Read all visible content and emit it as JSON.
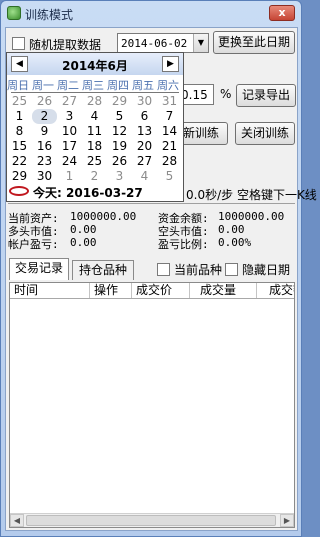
{
  "window": {
    "title": "训练模式",
    "close_label": "x"
  },
  "toolbar": {
    "random_checkbox_label": "随机提取数据",
    "date_value": "2014-06-02",
    "change_date_button": "更换至此日期",
    "percent_value": "0.15",
    "percent_unit": "%",
    "export_button": "记录导出",
    "new_training_button": "新训练",
    "close_training_button": "关闭训练",
    "speed_text": "0.0秒/步 空格键下一K线"
  },
  "calendar": {
    "title": "2014年6月",
    "prev_symbol": "◀",
    "next_symbol": "▶",
    "weekdays": [
      "周日",
      "周一",
      "周二",
      "周三",
      "周四",
      "周五",
      "周六"
    ],
    "weeks": [
      [
        "25",
        "26",
        "27",
        "28",
        "29",
        "30",
        "31"
      ],
      [
        "1",
        "2",
        "3",
        "4",
        "5",
        "6",
        "7"
      ],
      [
        "8",
        "9",
        "10",
        "11",
        "12",
        "13",
        "14"
      ],
      [
        "15",
        "16",
        "17",
        "18",
        "19",
        "20",
        "21"
      ],
      [
        "22",
        "23",
        "24",
        "25",
        "26",
        "27",
        "28"
      ],
      [
        "29",
        "30",
        "1",
        "2",
        "3",
        "4",
        "5"
      ]
    ],
    "selected_day": "2",
    "today_label": "今天:",
    "today_value": "2016-03-27"
  },
  "stats": {
    "current_assets_label": "当前资产:",
    "current_assets_value": "1000000.00",
    "cash_balance_label": "资金余额:",
    "cash_balance_value": "1000000.00",
    "long_value_label": "多头市值:",
    "long_value_value": "0.00",
    "short_value_label": "空头市值:",
    "short_value_value": "0.00",
    "pnl_label": "帐户盈亏:",
    "pnl_value": "0.00",
    "pnl_ratio_label": "盈亏比例:",
    "pnl_ratio_value": "0.00%"
  },
  "tabs": {
    "trade_records": "交易记录",
    "positions": "持仓品种",
    "current_symbol_label": "当前品种",
    "hide_date_label": "隐藏日期"
  },
  "table": {
    "columns": [
      "时间",
      "操作",
      "成交价",
      "成交量",
      "成交额"
    ]
  }
}
